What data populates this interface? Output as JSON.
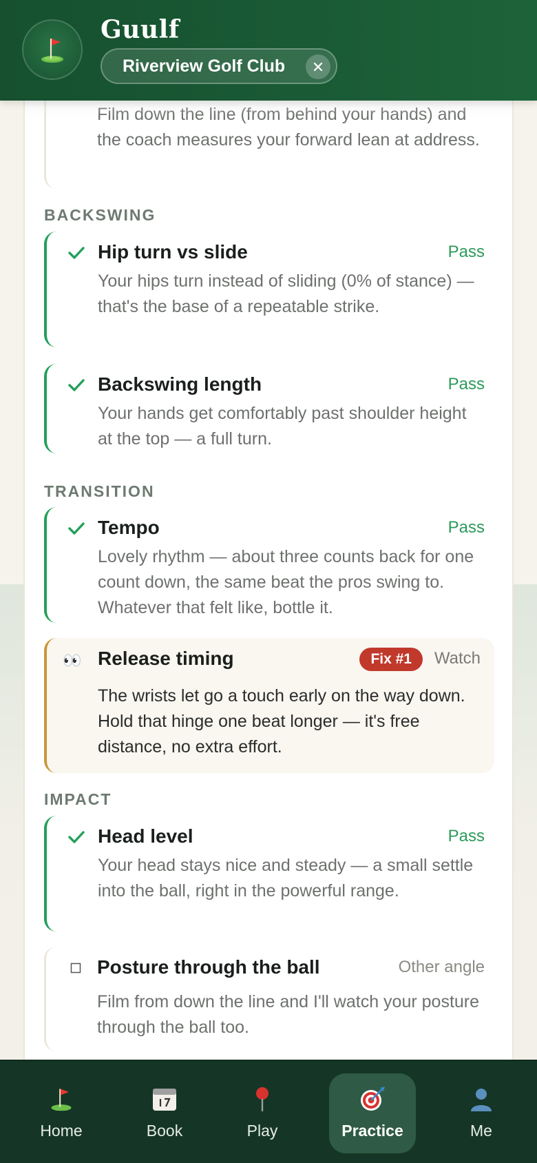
{
  "header": {
    "app_title": "Guulf",
    "club_name": "Riverview Golf Club",
    "logo_icon": "golf-flag-icon",
    "close_icon": "close-icon"
  },
  "intro_text": "Film down the line (from behind your hands) and the coach measures your forward lean at address.",
  "sections": [
    {
      "label": "BACKSWING",
      "checks": [
        {
          "title": "Hip turn vs slide",
          "verdict": "Pass",
          "description": "Your hips turn instead of sliding (0% of stance) — that's the base of a repeatable strike."
        },
        {
          "title": "Backswing length",
          "verdict": "Pass",
          "description": "Your hands get comfortably past shoulder height at the top — a full turn."
        }
      ]
    },
    {
      "label": "TRANSITION",
      "checks": [
        {
          "title": "Tempo",
          "verdict": "Pass",
          "description": "Lovely rhythm — about three counts back for one count down, the same beat the pros swing to. Whatever that felt like, bottle it."
        },
        {
          "title": "Release timing",
          "verdict": "Watch",
          "badge": "Fix #1",
          "icon": "👀",
          "description": "The wrists let go a touch early on the way down. Hold that hinge one beat longer — it's free distance, no extra effort."
        }
      ]
    },
    {
      "label": "IMPACT",
      "checks": [
        {
          "title": "Head level",
          "verdict": "Pass",
          "description": "Your head stays nice and steady — a small settle into the ball, right in the powerful range."
        },
        {
          "title": "Posture through the ball",
          "verdict": "Other angle",
          "description": "Film from down the line and I'll watch your posture through the ball too."
        }
      ]
    }
  ],
  "nav": [
    {
      "label": "Home",
      "icon": "⛳"
    },
    {
      "label": "Book",
      "icon": "📅"
    },
    {
      "label": "Play",
      "icon": "📍"
    },
    {
      "label": "Practice",
      "icon": "🎯",
      "active": true
    },
    {
      "label": "Me",
      "icon": "👤"
    }
  ],
  "colors": {
    "header_green": "#1a5a35",
    "pass_green": "#23a05a",
    "watch_amber": "#c9953a",
    "fix_red": "#c0392b",
    "nav_bg": "#153626"
  }
}
